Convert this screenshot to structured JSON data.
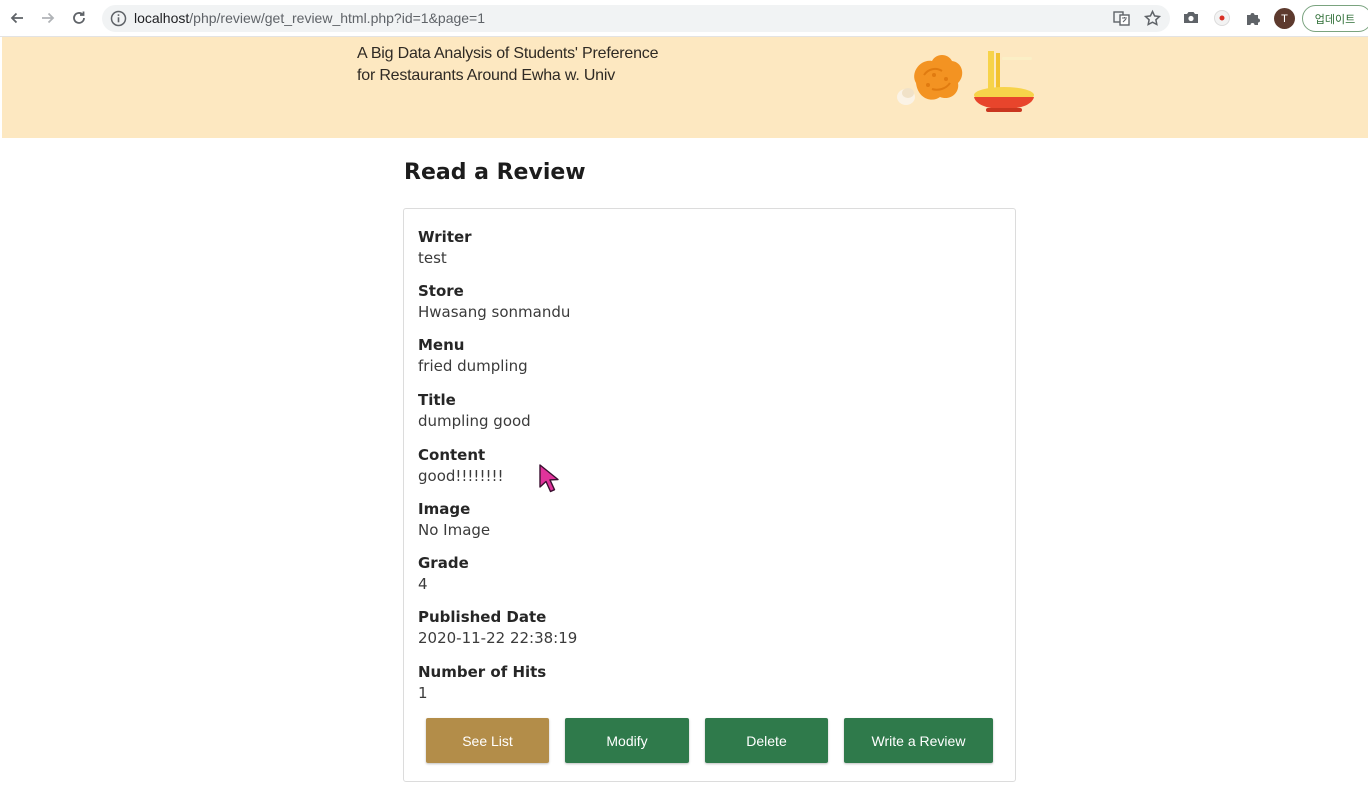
{
  "browser": {
    "url_host": "localhost",
    "url_path": "/php/review/get_review_html.php?id=1&page=1",
    "avatar_letter": "T",
    "update_label": "업데이트"
  },
  "banner": {
    "title_line1": "A Big Data Analysis of Students' Preference",
    "title_line2": "for Restaurants Around Ewha w. Univ",
    "background_color": "#fde8c1"
  },
  "page": {
    "title": "Read a Review"
  },
  "review": {
    "fields": [
      {
        "label": "Writer",
        "value": "test"
      },
      {
        "label": "Store",
        "value": "Hwasang sonmandu"
      },
      {
        "label": "Menu",
        "value": "fried dumpling"
      },
      {
        "label": "Title",
        "value": "dumpling good"
      },
      {
        "label": "Content",
        "value": "good!!!!!!!!"
      },
      {
        "label": "Image",
        "value": "No Image"
      },
      {
        "label": "Grade",
        "value": "4"
      },
      {
        "label": "Published Date",
        "value": "2020-11-22 22:38:19"
      },
      {
        "label": "Number of Hits",
        "value": "1"
      }
    ]
  },
  "actions": {
    "see_list": "See List",
    "modify": "Modify",
    "delete": "Delete",
    "write_review": "Write a Review"
  },
  "colors": {
    "gold_button": "#b38d49",
    "green_button": "#2f7a4b"
  },
  "icons": [
    "back-icon",
    "forward-icon",
    "reload-icon",
    "info-icon",
    "translate-icon",
    "star-icon",
    "camera-icon",
    "record-icon",
    "extensions-icon",
    "fried-chicken-icon",
    "noodle-bowl-icon",
    "cursor-icon"
  ]
}
